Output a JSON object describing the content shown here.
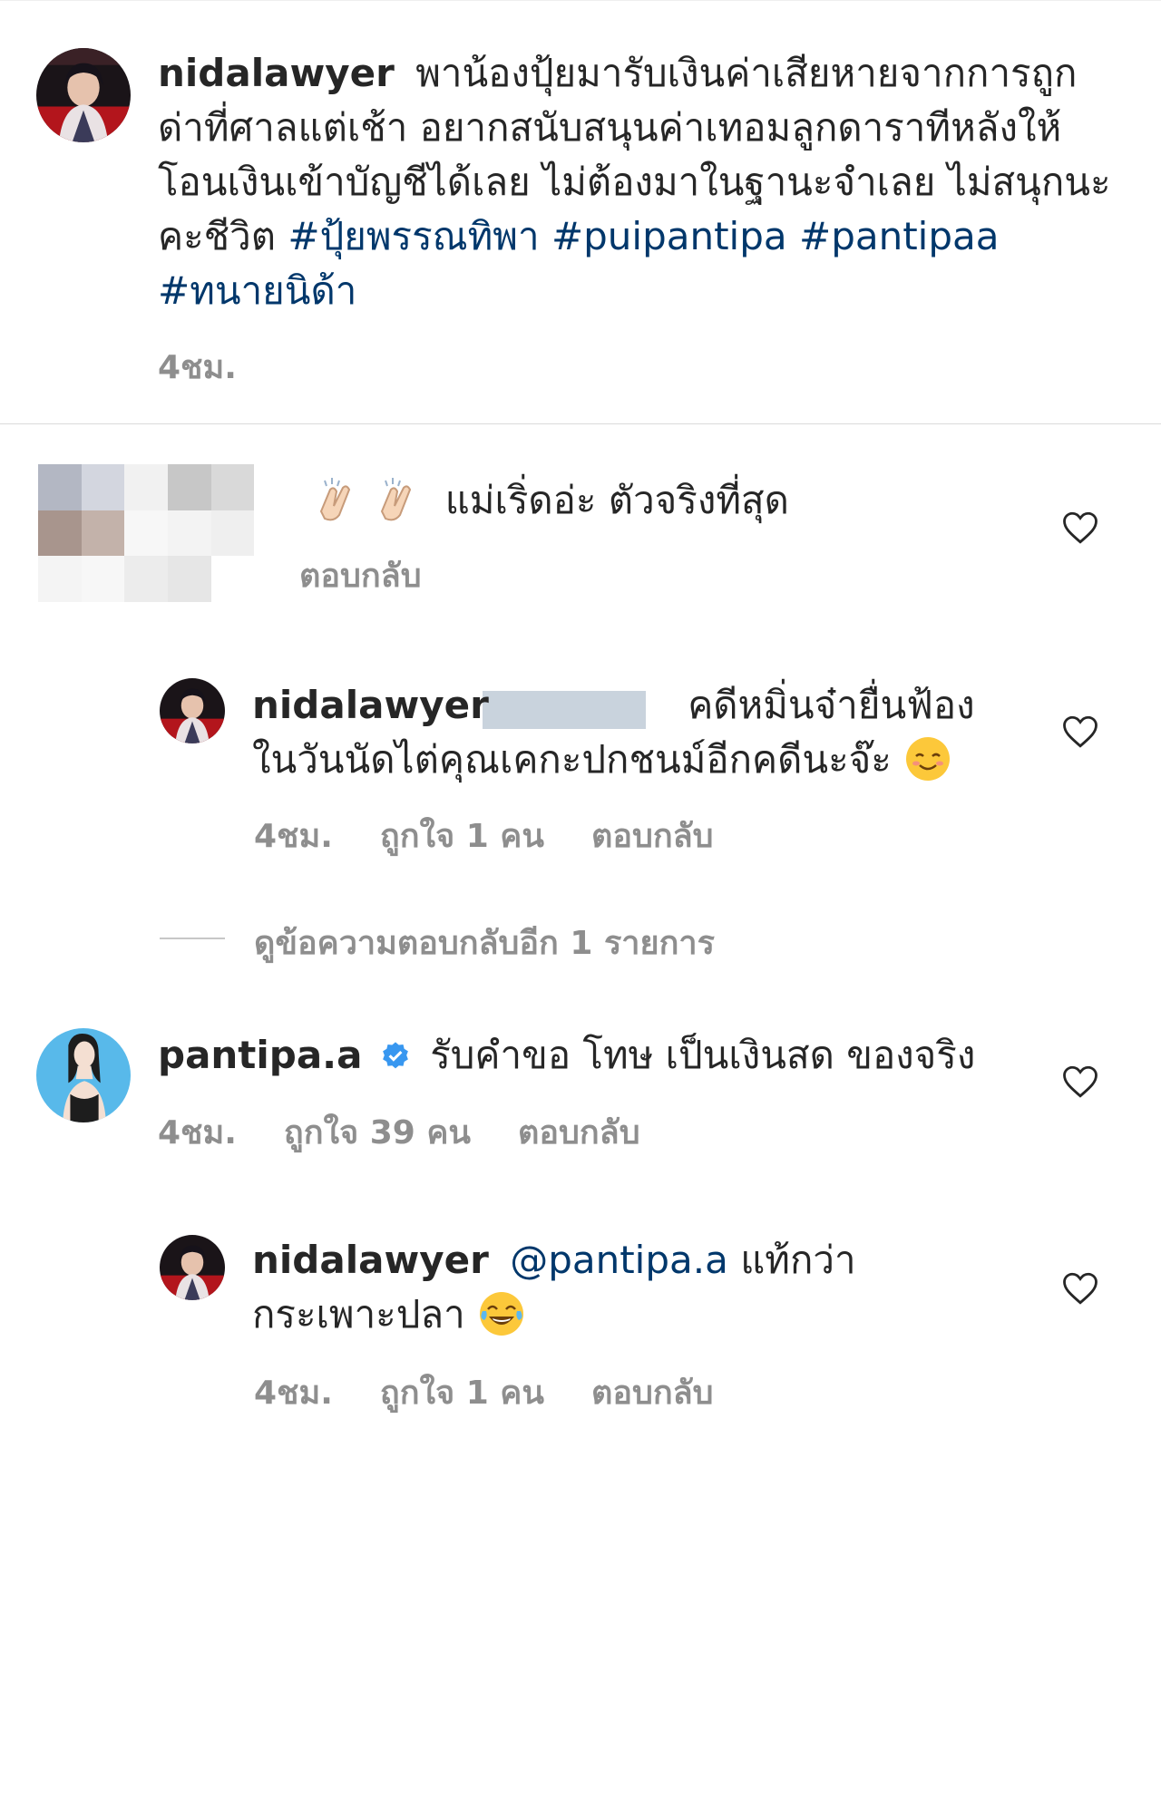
{
  "post": {
    "username": "nidalawyer",
    "caption": "พาน้องปุ้ยมารับเงินค่าเสียหายจากการถูกด่าที่ศาลแต่เช้า อยากสนับสนุนค่าเทอมลูกดาราทีหลังให้โอนเงินเข้าบัญชีได้เลย ไม่ต้องมาในฐานะจำเลย ไม่สนุกนะคะชีวิต",
    "hashtags": [
      "#ปุ้ยพรรณทิพา",
      "#puipantipa",
      "#pantipaa",
      "#ทนายนิด้า"
    ],
    "time": "4ชม."
  },
  "comments": [
    {
      "username": "",
      "text": "แม่เริ่ดอ่ะ ตัวจริงที่สุด",
      "reply_label": "ตอบกลับ",
      "replies": [
        {
          "username": "nidalawyer",
          "mention": "",
          "text": "คดีหมิ่นจ๋ายื่นฟ้องในวันนัดไต่คุณเคกะปกชนม์อีกคดีนะจ๊ะ",
          "time": "4ชม.",
          "likes": "ถูกใจ 1 คน",
          "reply_label": "ตอบกลับ"
        }
      ],
      "view_more": "ดูข้อความตอบกลับอีก 1 รายการ"
    },
    {
      "username": "pantipa.a",
      "text": "รับคำขอ โทษ เป็นเงินสด ของจริง",
      "time": "4ชม.",
      "likes": "ถูกใจ 39 คน",
      "reply_label": "ตอบกลับ",
      "replies": [
        {
          "username": "nidalawyer",
          "mention": "@pantipa.a",
          "text": "แท้กว่ากระเพาะปลา",
          "time": "4ชม.",
          "likes": "ถูกใจ 1 คน",
          "reply_label": "ตอบกลับ"
        }
      ]
    }
  ],
  "icons": {
    "like": "heart-outline-icon",
    "verified": "verified-badge-icon",
    "clap": "clapping-hands-emoji",
    "smile": "smiling-face-emoji",
    "laugh": "tears-of-joy-emoji"
  },
  "colors": {
    "text": "#262626",
    "secondary": "#8e8e8e",
    "link": "#00376b",
    "verified": "#3897f0"
  }
}
